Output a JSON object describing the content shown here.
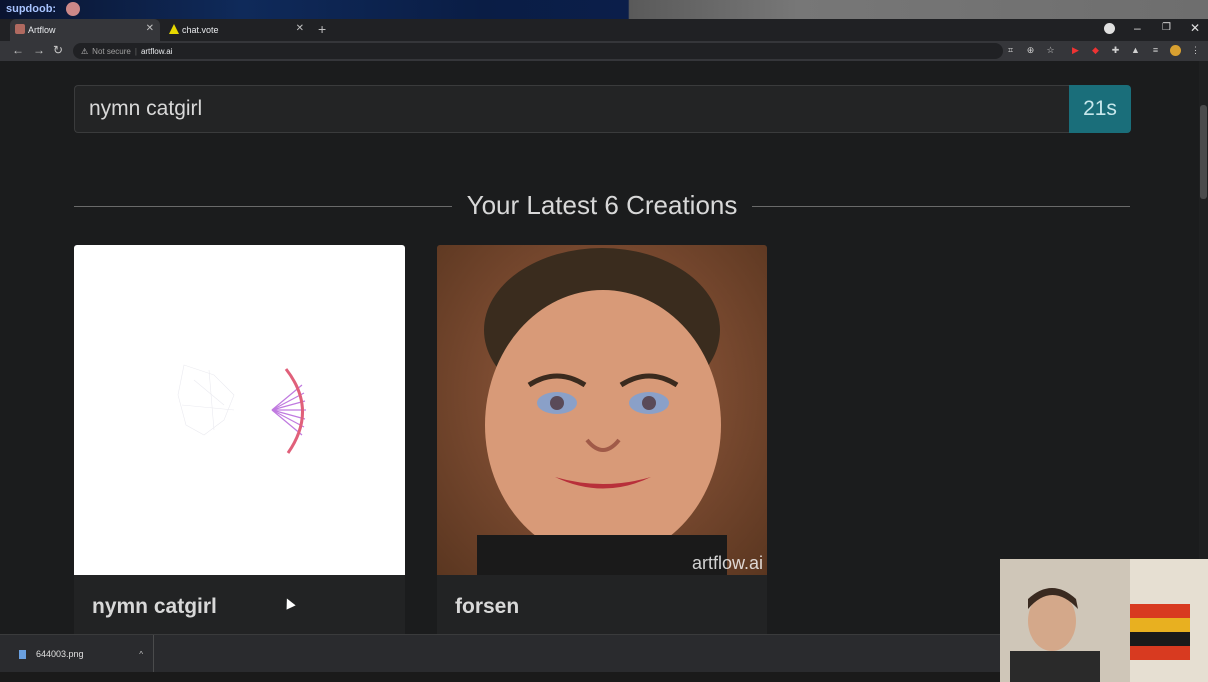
{
  "stream": {
    "username": "supdoob:"
  },
  "tabs": [
    {
      "label": "Artflow",
      "active": true
    },
    {
      "label": "chat.vote",
      "active": false
    }
  ],
  "addressbar": {
    "security_label": "Not secure",
    "url": "artflow.ai"
  },
  "search": {
    "value": "nymn catgirl",
    "timer": "21s"
  },
  "section": {
    "title": "Your Latest 6 Creations"
  },
  "creations": [
    {
      "label": "nymn catgirl"
    },
    {
      "label": "forsen",
      "watermark": "artflow.ai"
    }
  ],
  "download": {
    "filename": "644003.png"
  },
  "colors": {
    "accent": "#1a6e7a",
    "background": "#1b1c1d"
  }
}
